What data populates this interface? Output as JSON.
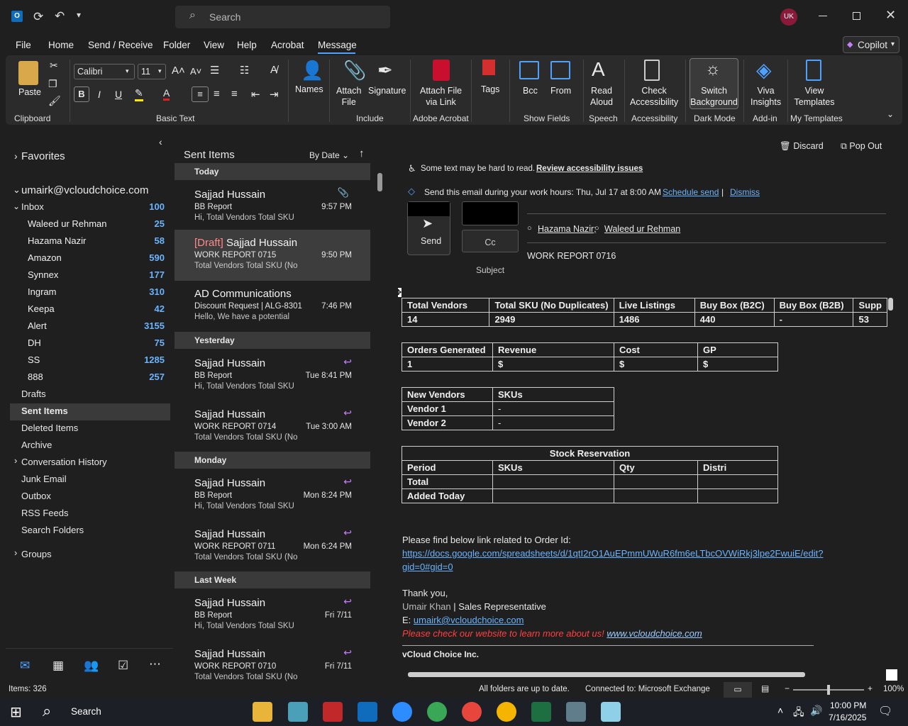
{
  "titlebar": {
    "search_placeholder": "Search",
    "avatar_initials": "UK"
  },
  "menu": [
    "File",
    "Home",
    "Send / Receive",
    "Folder",
    "View",
    "Help",
    "Acrobat",
    "Message"
  ],
  "copilot_label": "Copilot",
  "ribbon": {
    "paste": "Paste",
    "font_name": "Calibri",
    "font_size": "11",
    "groups": {
      "clipboard": "Clipboard",
      "basic_text": "Basic Text",
      "include": "Include",
      "adobe": "Adobe Acrobat",
      "show_fields": "Show Fields",
      "speech": "Speech",
      "accessibility": "Accessibility",
      "dark_mode": "Dark Mode",
      "addin": "Add-in",
      "templates": "My Templates"
    },
    "buttons": {
      "names": "Names",
      "attach_file_1": "Attach",
      "attach_file_2": "File",
      "signature": "Signature",
      "attach_link_1": "Attach File",
      "attach_link_2": "via Link",
      "tags": "Tags",
      "bcc": "Bcc",
      "from": "From",
      "read_1": "Read",
      "read_2": "Aloud",
      "check_1": "Check",
      "check_2": "Accessibility",
      "switch_1": "Switch",
      "switch_2": "Background",
      "viva_1": "Viva",
      "viva_2": "Insights",
      "view_1": "View",
      "view_2": "Templates"
    }
  },
  "folders": {
    "favorites": "Favorites",
    "account": "umairk@vcloudchoice.com",
    "inbox": {
      "label": "Inbox",
      "count": "100"
    },
    "subfolders": [
      {
        "label": "Waleed ur Rehman",
        "count": "25"
      },
      {
        "label": "Hazama Nazir",
        "count": "58"
      },
      {
        "label": "Amazon",
        "count": "590"
      },
      {
        "label": "Synnex",
        "count": "177"
      },
      {
        "label": "Ingram",
        "count": "310"
      },
      {
        "label": "Keepa",
        "count": "42"
      },
      {
        "label": "Alert",
        "count": "3155"
      },
      {
        "label": "DH",
        "count": "75"
      },
      {
        "label": "SS",
        "count": "1285"
      },
      {
        "label": "888",
        "count": "257"
      }
    ],
    "others": [
      "Drafts",
      "Sent Items",
      "Deleted Items",
      "Archive",
      "Conversation History",
      "Junk Email",
      "Outbox",
      "RSS Feeds",
      "Search Folders"
    ],
    "groups": "Groups"
  },
  "list": {
    "title": "Sent Items",
    "sort": "By Date",
    "groups": [
      "Today",
      "Yesterday",
      "Monday",
      "Last Week"
    ],
    "messages": [
      {
        "from": "Sajjad Hussain",
        "draft": "",
        "subject": "BB Report",
        "preview": "Hi,  Total Vendors  Total SKU",
        "time": "9:57 PM"
      },
      {
        "from": "Sajjad Hussain",
        "draft": "[Draft]",
        "subject": "WORK REPORT 0715",
        "preview": "Total Vendors  Total SKU (No",
        "time": "9:50 PM"
      },
      {
        "from": "AD Communications",
        "draft": "",
        "subject": "Discount Request | ALG-8301",
        "preview": "Hello,  We have a potential",
        "time": "7:46 PM"
      },
      {
        "from": "Sajjad Hussain",
        "draft": "",
        "subject": "BB Report",
        "preview": "Hi,  Total Vendors  Total SKU",
        "time": "Tue 8:41 PM"
      },
      {
        "from": "Sajjad Hussain",
        "draft": "",
        "subject": "WORK REPORT 0714",
        "preview": "Total Vendors  Total SKU (No",
        "time": "Tue 3:00 AM"
      },
      {
        "from": "Sajjad Hussain",
        "draft": "",
        "subject": "BB Report",
        "preview": "Hi,  Total Vendors  Total SKU",
        "time": "Mon 8:24 PM"
      },
      {
        "from": "Sajjad Hussain",
        "draft": "",
        "subject": "WORK REPORT 0711",
        "preview": "Total Vendors  Total SKU (No",
        "time": "Mon 6:24 PM"
      },
      {
        "from": "Sajjad Hussain",
        "draft": "",
        "subject": "BB Report",
        "preview": "Hi,  Total Vendors  Total SKU",
        "time": "Fri 7/11"
      },
      {
        "from": "Sajjad Hussain",
        "draft": "",
        "subject": "WORK REPORT 0710",
        "preview": "Total Vendors  Total SKU (No",
        "time": "Fri 7/11"
      }
    ]
  },
  "reading": {
    "discard": "Discard",
    "popout": "Pop Out",
    "accessibility_msg": "Some text may be hard to read.",
    "accessibility_link": "Review accessibility issues",
    "schedule_msg": "Send this email during your work hours: Thu, Jul 17 at 8:00 AM",
    "schedule_link": "Schedule send",
    "dismiss": "Dismiss",
    "send": "Send",
    "cc": "Cc",
    "subject_label": "Subject",
    "cc_recipients": [
      "Hazama Nazir;",
      "Waleed ur Rehman"
    ],
    "subject_value": "WORK REPORT 0716",
    "table1": {
      "headers": [
        "Total Vendors",
        "Total SKU (No Duplicates)",
        "Live Listings",
        "Buy Box (B2C)",
        "Buy Box (B2B)",
        "Supp"
      ],
      "values": [
        "14",
        "2949",
        "1486",
        "440",
        "-",
        "53"
      ]
    },
    "table2": {
      "headers": [
        "Orders Generated",
        "Revenue",
        "Cost",
        "GP"
      ],
      "values": [
        "1",
        "$",
        "$",
        "$"
      ]
    },
    "table3": {
      "headers": [
        "New Vendors",
        "SKUs"
      ],
      "rows": [
        [
          "Vendor 1",
          "-"
        ],
        [
          "Vendor 2",
          "-"
        ]
      ]
    },
    "table4": {
      "title": "Stock Reservation",
      "headers": [
        "Period",
        "SKUs",
        "Qty",
        "Distri"
      ],
      "rows": [
        "Total",
        "Added Today"
      ]
    },
    "body_intro": "Please find below link related to Order Id:",
    "doc_link_1": "https://docs.google.com/spreadsheets/d/1qtI2rO1AuEPmmUWuR6fm6eLTbcOVWiRkj3lpe2FwuiE/edit?",
    "doc_link_2": "gid=0#gid=0",
    "thanks": "Thank you,",
    "sig_name": "Umair Khan",
    "sig_title": "Sales Representative",
    "sig_email_label": "E:",
    "sig_email": "umairk@vcloudchoice.com",
    "sig_promo": "Please check our website to learn more about us!",
    "sig_site": "www.vcloudchoice.com",
    "company": "vCloud Choice Inc."
  },
  "status": {
    "items": "Items: 326",
    "sync": "All folders are up to date.",
    "connection": "Connected to: Microsoft Exchange",
    "zoom": "100%"
  },
  "taskbar": {
    "search": "Search",
    "time": "10:00 PM",
    "date": "7/16/2025"
  },
  "colors": {
    "accent": "#4ea1ff",
    "ribbon_bg": "#2b2b2b",
    "count_blue": "#6ab4ff",
    "avatar": "#8b1a3a"
  }
}
